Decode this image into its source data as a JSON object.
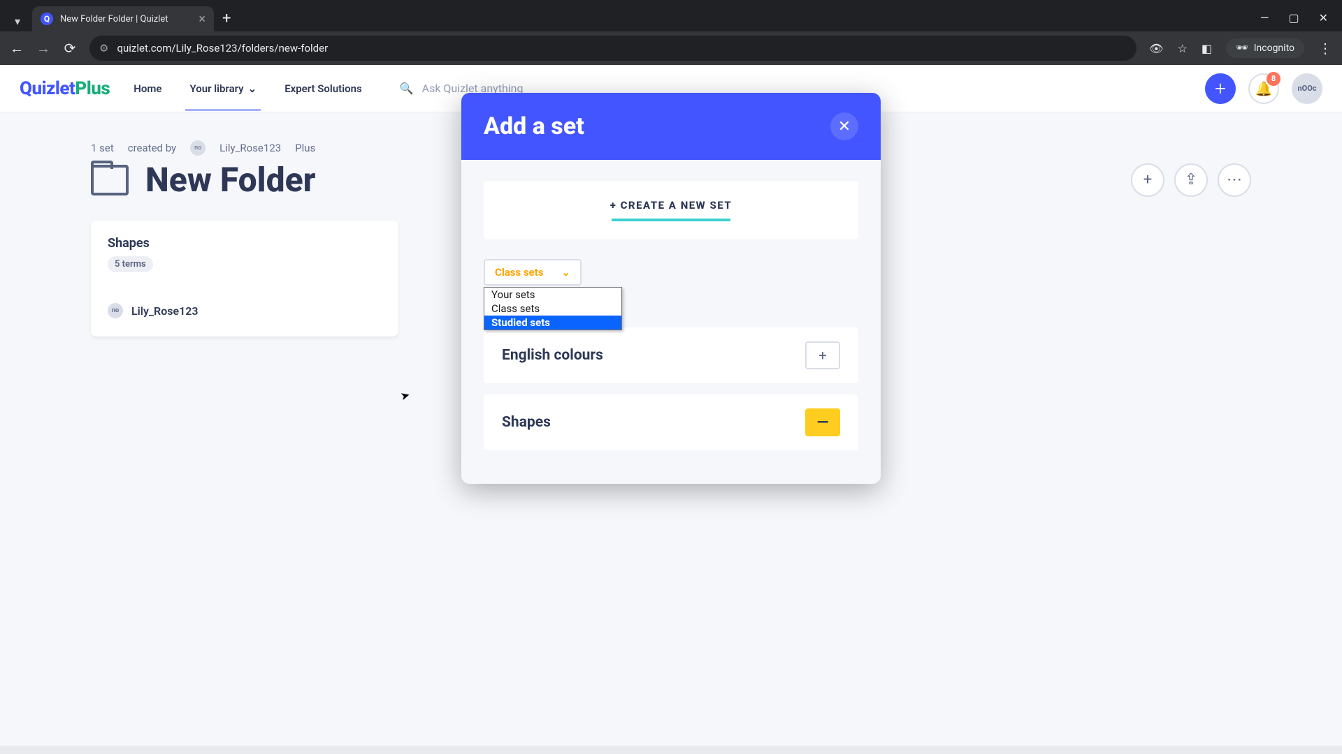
{
  "browser": {
    "tab_title": "New Folder Folder | Quizlet",
    "url": "quizlet.com/Lily_Rose123/folders/new-folder",
    "incognito_label": "Incognito"
  },
  "header": {
    "logo_main": "Quizlet",
    "logo_suffix": "Plus",
    "nav": {
      "home": "Home",
      "library": "Your library",
      "expert": "Expert Solutions"
    },
    "search_placeholder": "Ask Quizlet anything",
    "notification_count": "8"
  },
  "folder": {
    "set_count": "1 set",
    "created_by_label": "created by",
    "creator": "Lily_Rose123",
    "plus_badge": "Plus",
    "title": "New Folder"
  },
  "sidebar_card": {
    "name": "Shapes",
    "terms": "5 terms",
    "author": "Lily_Rose123"
  },
  "modal": {
    "title": "Add a set",
    "create_label": "+ CREATE A NEW SET",
    "dropdown_selected": "Class sets",
    "dropdown_options": {
      "opt0": "Your sets",
      "opt1": "Class sets",
      "opt2": "Studied sets"
    },
    "sets": {
      "row0": "English colours",
      "row1": "Shapes"
    }
  }
}
